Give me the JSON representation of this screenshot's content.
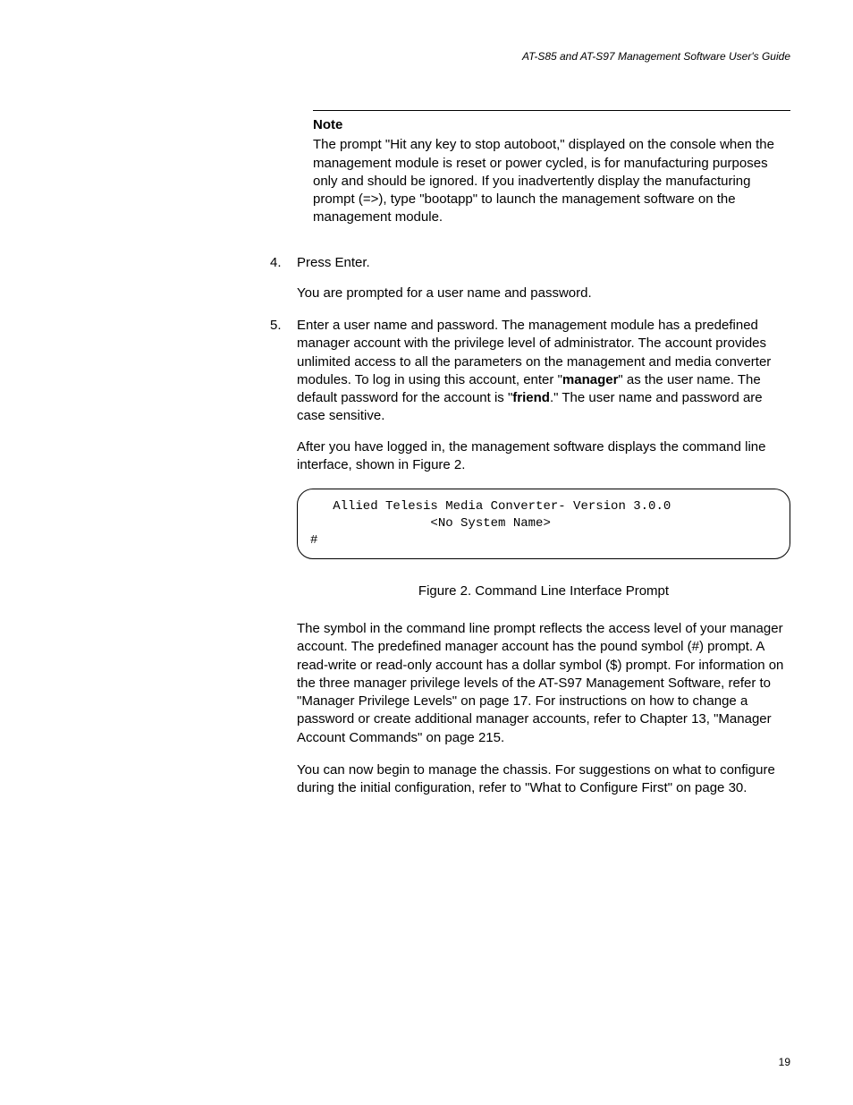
{
  "header": {
    "running": "AT-S85 and AT-S97 Management Software User's Guide"
  },
  "note": {
    "heading": "Note",
    "body_1": "The prompt \"Hit any key to stop autoboot,\" displayed on the console when the management module is reset or power cycled, is for manufacturing purposes only and should be ignored. If you inadvertently display the manufacturing prompt (=>), type \"bootapp\" to launch the management software on the management module."
  },
  "step4": {
    "num": "4.",
    "text": "Press Enter.",
    "followup": "You are prompted for a user name and password."
  },
  "step5": {
    "num": "5.",
    "pre1": "Enter a user name and password. The management module has a predefined manager account with the privilege level of administrator. The account provides unlimited access to all the parameters on the management and media converter modules. To log in using this account, enter \"",
    "bold1": "manager",
    "mid1": "\" as the user name. The default password for the account is \"",
    "bold2": "friend",
    "post1": ".\" The user name and password are case sensitive.",
    "followup": "After you have logged in, the management software displays the command line interface, shown in Figure 2."
  },
  "cli": {
    "line1": "   Allied Telesis Media Converter- Version 3.0.0",
    "line2": "                <No System Name>",
    "line3": "#"
  },
  "figure": {
    "caption": "Figure 2. Command Line Interface Prompt"
  },
  "para1": "The symbol in the command line prompt reflects the access level of your manager account. The predefined manager account has the pound symbol (#) prompt. A read-write or read-only account has a dollar symbol ($) prompt. For information on the three manager privilege levels of the AT-S97 Management Software, refer to \"Manager Privilege Levels\" on page 17. For instructions on how to change a password or create additional manager accounts, refer to Chapter 13, \"Manager Account Commands\" on page 215.",
  "para2": "You can now begin to manage the chassis. For suggestions on what to configure during the initial configuration, refer to \"What to Configure First\" on page 30.",
  "page_number": "19"
}
